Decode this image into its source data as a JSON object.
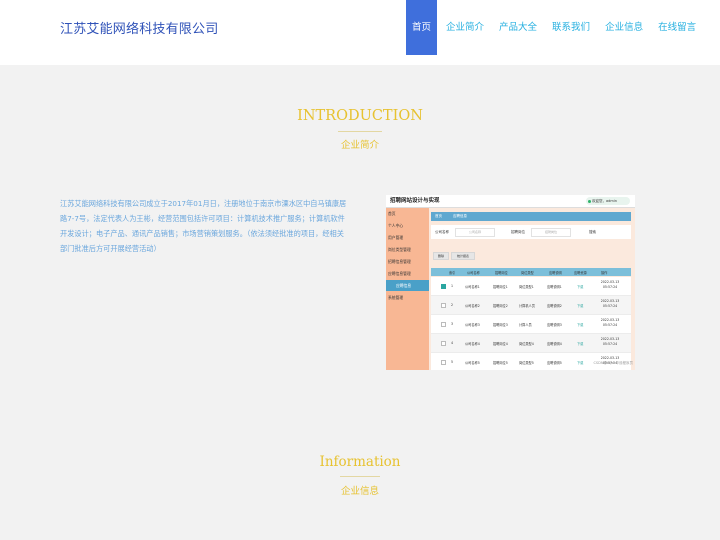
{
  "header": {
    "logo_text": "江苏艾能网络科技有限公司",
    "nav": [
      "首页",
      "企业简介",
      "产品大全",
      "联系我们",
      "企业信息",
      "在线留言"
    ],
    "active_index": 0
  },
  "intro": {
    "title": "INTRODUCTION",
    "subtitle": "企业简介",
    "text": "江苏艾能网络科技有限公司成立于2017年01月日，注册地位于南京市溧水区中自马镇康居路7-7号，法定代表人为王彬，经营范围包括许可项目：计算机技术推广服务；计算机软件开发设计；电子产品、通讯产品销售；市场营销策划服务。（依法须经批准的项目，经相关部门批准后方可开展经营活动）"
  },
  "screenshot": {
    "title": "招聘网站设计与实现",
    "user_pill": "欢迎您，admin",
    "sidebar": [
      "首页",
      "个人中心",
      "用户管理",
      "岗位类型管理",
      "招聘信息管理",
      "应聘信息管理",
      "应聘信息",
      "系统管理"
    ],
    "sidebar_selected": 6,
    "tabs": [
      "首页",
      "应聘信息"
    ],
    "search_labels": [
      "公司名称",
      "招聘岗位"
    ],
    "search_placeholders": [
      "公司名称",
      "招聘岗位"
    ],
    "search_button": "搜索",
    "buttons": [
      "删除",
      "统计报表"
    ],
    "table_headers": [
      "索引",
      "公司名称",
      "招聘岗位",
      "岗位类型",
      "应聘说明",
      "应聘资源",
      "操作"
    ],
    "rows": [
      {
        "idx": "1",
        "company": "公司名称1",
        "post": "招聘岗位1",
        "type": "岗位类型1",
        "desc": "应聘说明1",
        "res": "下载",
        "time": "2022-03-13 05:57:24",
        "checked": true
      },
      {
        "idx": "2",
        "company": "公司名称2",
        "post": "招聘岗位2",
        "type": "计算机人员",
        "desc": "应聘说明2",
        "res": "下载",
        "time": "2022-03-13 05:57:24",
        "checked": false
      },
      {
        "idx": "3",
        "company": "公司名称3",
        "post": "招聘岗位3",
        "type": "计算人员",
        "desc": "应聘说明3",
        "res": "下载",
        "time": "2022-03-13 05:57:24",
        "checked": false
      },
      {
        "idx": "4",
        "company": "公司名称4",
        "post": "招聘岗位4",
        "type": "岗位类型4",
        "desc": "应聘说明4",
        "res": "下载",
        "time": "2022-03-13 05:57:24",
        "checked": false
      },
      {
        "idx": "5",
        "company": "公司名称5",
        "post": "招聘岗位5",
        "type": "岗位类型5",
        "desc": "应聘说明5",
        "res": "下载",
        "time": "2022-03-13 05:57:24",
        "checked": false
      }
    ],
    "watermark": "CSDN@biye 毕设程序员"
  },
  "info": {
    "title": "Information",
    "subtitle": "企业信息"
  }
}
